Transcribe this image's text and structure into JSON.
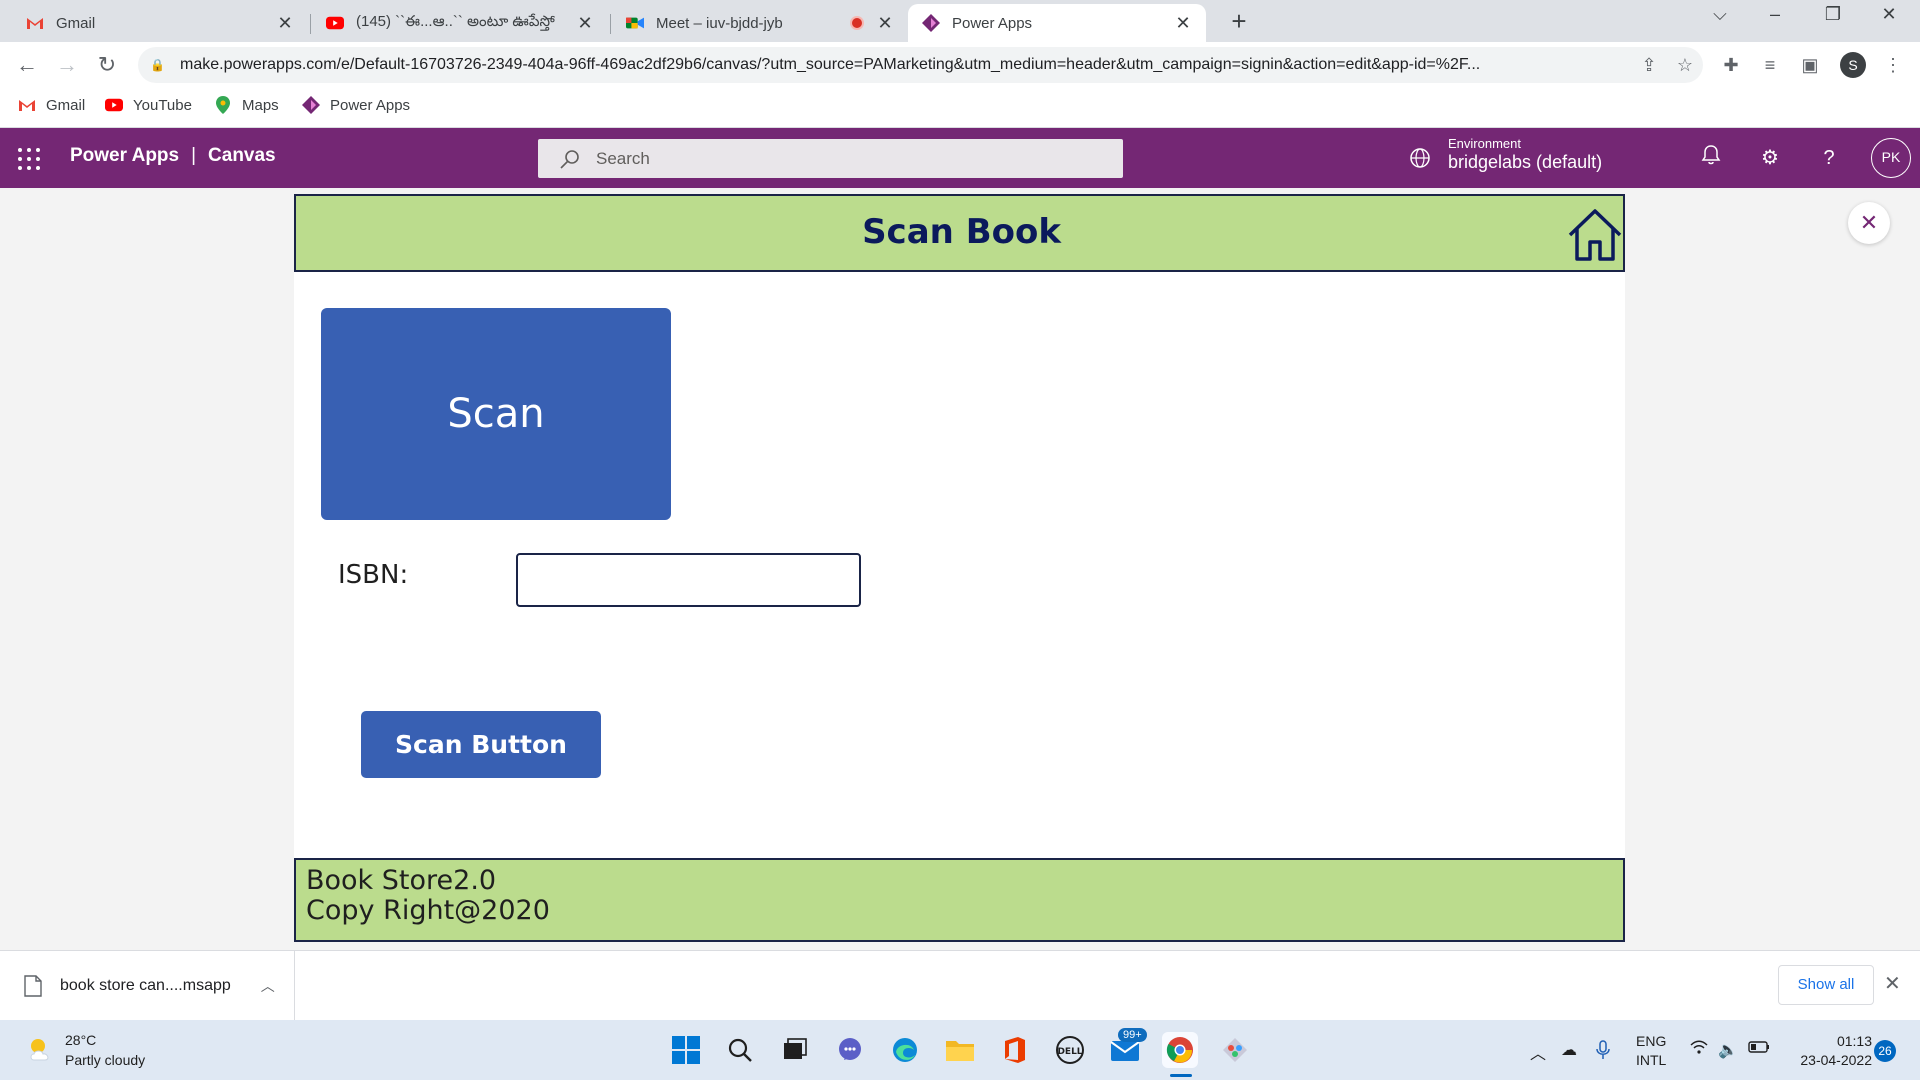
{
  "browser": {
    "tabs": [
      {
        "title": "Gmail",
        "icon": "gmail-icon"
      },
      {
        "title": "(145) ``ఈ...ఆ..`` అంటూ ఊపేస్తో",
        "icon": "youtube-icon"
      },
      {
        "title": "Meet – iuv-bjdd-jyb",
        "icon": "meet-icon"
      },
      {
        "title": "Power Apps",
        "icon": "power-apps-icon"
      }
    ],
    "url": "make.powerapps.com/e/Default-16703726-2349-404a-96ff-469ac2df29b6/canvas/?utm_source=PAMarketing&utm_medium=header&utm_campaign=signin&action=edit&app-id=%2F...",
    "profile_initial": "S",
    "bookmarks": [
      {
        "label": "Gmail",
        "icon": "gmail-icon"
      },
      {
        "label": "YouTube",
        "icon": "youtube-icon"
      },
      {
        "label": "Maps",
        "icon": "maps-icon"
      },
      {
        "label": "Power Apps",
        "icon": "power-apps-icon"
      }
    ]
  },
  "powerapps": {
    "brand": "Power Apps",
    "section": "Canvas",
    "search_placeholder": "Search",
    "environment_label": "Environment",
    "environment_name": "bridgelabs (default)",
    "avatar_initials": "PK",
    "header_color": "#742774"
  },
  "app": {
    "title": "Scan Book",
    "scan_tile_label": "Scan",
    "isbn_label": "ISBN:",
    "isbn_value": "",
    "scan_button_label": "Scan Button",
    "footer_line1": "Book Store2.0",
    "footer_line2": "Copy Right@2020",
    "header_color": "#bbdc8d",
    "button_color": "#3860b3"
  },
  "downloads": {
    "file_name": "book store can....msapp",
    "show_all": "Show all"
  },
  "taskbar": {
    "temperature": "28°C",
    "weather": "Partly cloudy",
    "mail_badge": "99+",
    "language_line1": "ENG",
    "language_line2": "INTL",
    "time": "01:13",
    "date": "23-04-2022",
    "notification_count": "26"
  }
}
